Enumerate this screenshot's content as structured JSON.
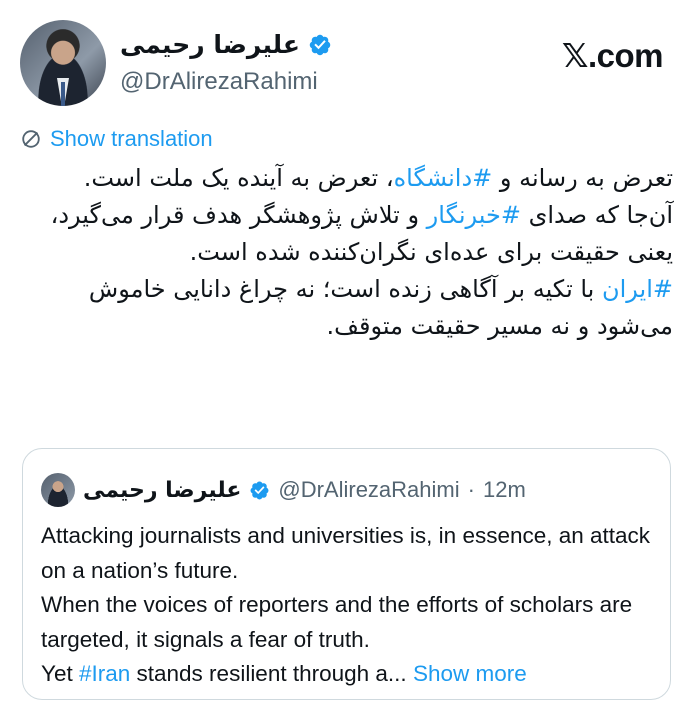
{
  "author": {
    "name": "علیرضا رحیمی",
    "handle": "@DrAlirezaRahimi",
    "verified": true
  },
  "site": {
    "x": "𝕏",
    "domain": ".com"
  },
  "translate_label": "Show translation",
  "tweet": {
    "l1a": "تعرض به رسانه و ",
    "l1tag": "#دانشگاه",
    "l1b": "، تعرض به آینده یک ملت است.",
    "l2a": "آن‌جا که صدای ",
    "l2tag": "#خبرنگار",
    "l2b": " و تلاش پژوهشگر هدف قرار می‌گیرد، یعنی حقیقت برای عده‌ای نگران‌کننده شده است.",
    "l3tag": "#ایران",
    "l3b": " با تکیه بر آگاهی زنده است؛ نه چراغ دانایی خاموش می‌شود و نه مسیر حقیقت متوقف."
  },
  "quote": {
    "name": "علیرضا رحیمی",
    "handle": "@DrAlirezaRahimi",
    "sep": "·",
    "time": "12m",
    "p1": "Attacking journalists and universities is, in essence, an attack on a nation’s future.",
    "p2": "When the voices of reporters and the efforts of scholars are targeted, it signals a fear of truth.",
    "p3a": "Yet ",
    "p3tag": "#Iran",
    "p3b": " stands resilient through a...",
    "show_more": "Show more"
  },
  "colors": {
    "link": "#1d9bf0",
    "secondary": "#536471",
    "border": "#cfd9de"
  },
  "icons": [
    "verified-badge-icon",
    "translate-globe-icon",
    "x-logo-icon"
  ]
}
